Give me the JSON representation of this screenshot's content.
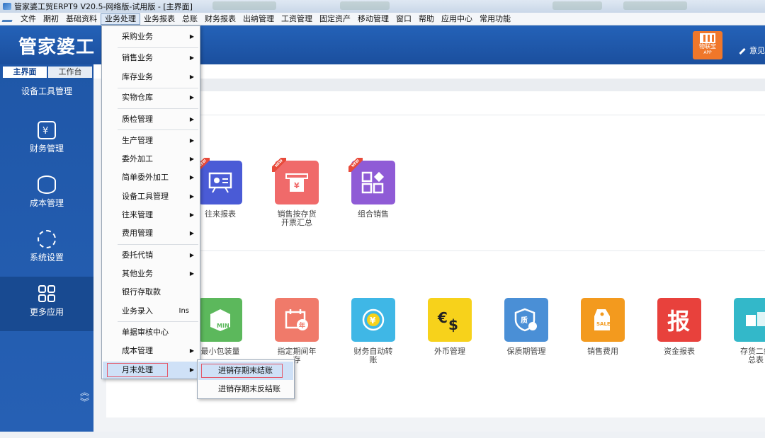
{
  "window": {
    "title": "管家婆工贸ERPT9 V20.5-网络版-试用版 - [主界面]"
  },
  "menubar": {
    "items": [
      "文件",
      "期初",
      "基础资料",
      "业务处理",
      "业务报表",
      "总账",
      "财务报表",
      "出纳管理",
      "工资管理",
      "固定资产",
      "移动管理",
      "窗口",
      "帮助",
      "应用中心",
      "常用功能"
    ],
    "active": "业务处理"
  },
  "header": {
    "logo": "管家婆工",
    "app_badge_line1": "物联宝",
    "app_badge_line2": "APP",
    "feedback": "意见"
  },
  "sidebar": {
    "tabs": [
      "主界面",
      "工作台"
    ],
    "items": [
      {
        "label": "设备工具管理",
        "icon": "gear-tool-icon"
      },
      {
        "label": "财务管理",
        "icon": "finance-icon"
      },
      {
        "label": "成本管理",
        "icon": "database-icon"
      },
      {
        "label": "系统设置",
        "icon": "settings-icon"
      },
      {
        "label": "更多应用",
        "icon": "grid-icon"
      }
    ],
    "scroll_up": "︽",
    "scroll_down": "︾"
  },
  "tiles_row1": [
    {
      "label": "往来报表",
      "color": "#4a5bd6",
      "new": true
    },
    {
      "label": "销售按存货\n开票汇总",
      "color": "#f06a6a",
      "new": true
    },
    {
      "label": "组合销售",
      "color": "#8f5bd6",
      "new": true
    }
  ],
  "tiles_row2": [
    {
      "label": "最小包装量",
      "color": "#5cb85c"
    },
    {
      "label": "指定期间年\n存",
      "color": "#f07a6a"
    },
    {
      "label": "财务自动转\n账",
      "color": "#3fb7e6"
    },
    {
      "label": "外币管理",
      "color": "#f7d21b"
    },
    {
      "label": "保质期管理",
      "color": "#4a8fd6"
    },
    {
      "label": "销售费用",
      "color": "#f39a1e"
    },
    {
      "label": "资金报表",
      "color": "#e8413c"
    },
    {
      "label": "存货二维\n总表",
      "color": "#33b8c9"
    }
  ],
  "dropdown": {
    "items": [
      {
        "label": "采购业务",
        "submenu": true
      },
      {
        "label": "销售业务",
        "submenu": true
      },
      {
        "label": "库存业务",
        "submenu": true
      },
      {
        "label": "实物仓库",
        "submenu": true
      },
      {
        "label": "质检管理",
        "submenu": true
      },
      {
        "label": "生产管理",
        "submenu": true
      },
      {
        "label": "委外加工",
        "submenu": true
      },
      {
        "label": "简单委外加工",
        "submenu": true
      },
      {
        "label": "设备工具管理",
        "submenu": true
      },
      {
        "label": "往来管理",
        "submenu": true
      },
      {
        "label": "费用管理",
        "submenu": true
      },
      {
        "label": "委托代销",
        "submenu": true
      },
      {
        "label": "其他业务",
        "submenu": true
      },
      {
        "label": "银行存取款",
        "submenu": false
      },
      {
        "label": "业务录入",
        "submenu": false,
        "shortcut": "Ins"
      },
      {
        "label": "单据审核中心",
        "submenu": false
      },
      {
        "label": "成本管理",
        "submenu": true
      },
      {
        "label": "月末处理",
        "submenu": true,
        "highlighted": true
      }
    ]
  },
  "submenu": {
    "items": [
      {
        "label": "进销存期末结账",
        "highlighted": true
      },
      {
        "label": "进销存期末反结账",
        "highlighted": false
      }
    ]
  }
}
